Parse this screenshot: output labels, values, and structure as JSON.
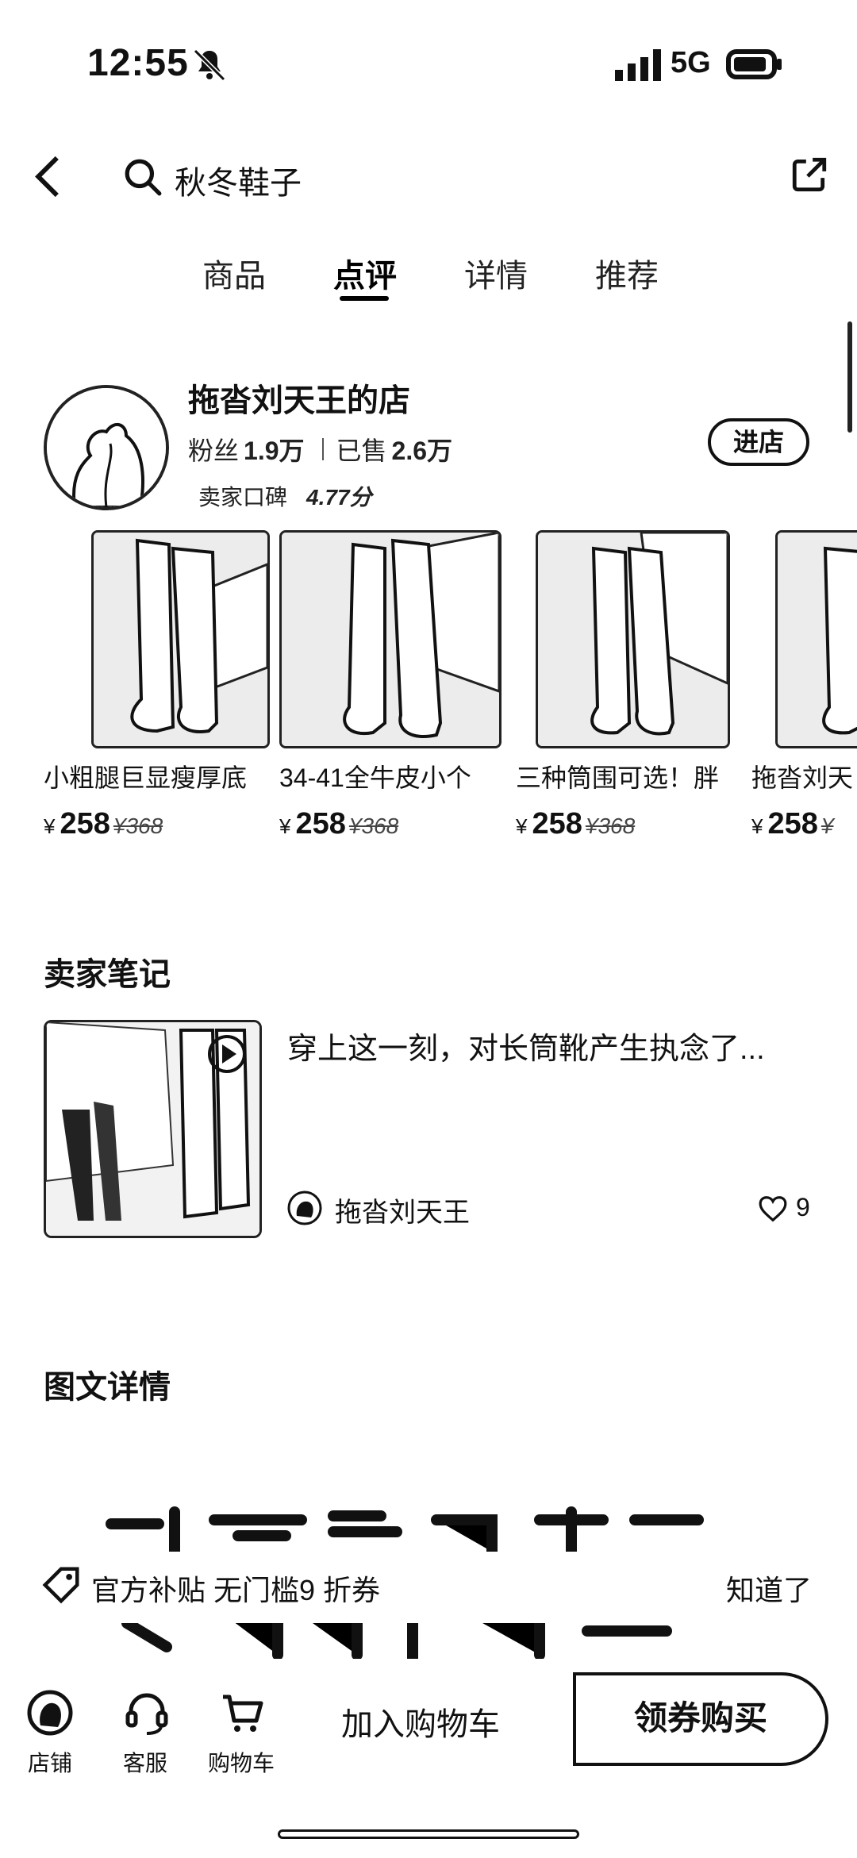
{
  "status_bar": {
    "time": "12:55",
    "network": "5G"
  },
  "header": {
    "search_query": "秋冬鞋子"
  },
  "tabs": [
    {
      "label": "商品"
    },
    {
      "label": "点评"
    },
    {
      "label": "详情"
    },
    {
      "label": "推荐"
    }
  ],
  "active_tab": "点评",
  "shop": {
    "name": "拖沓刘天王的店",
    "fans_label": "粉丝",
    "fans_count": "1.9万",
    "sold_label": "已售",
    "sold_count": "2.6万",
    "rating_label": "卖家口碑",
    "rating_value": "4.77分",
    "enter_label": "进店"
  },
  "products": [
    {
      "name": "小粗腿巨显瘦厚底",
      "currency": "¥",
      "price": "258",
      "original_price": "¥368"
    },
    {
      "name": "34-41全牛皮小个",
      "currency": "¥",
      "price": "258",
      "original_price": "¥368"
    },
    {
      "name": "三种筒围可选！胖",
      "currency": "¥",
      "price": "258",
      "original_price": "¥368"
    },
    {
      "name": "拖沓刘天",
      "currency": "¥",
      "price": "258",
      "original_price": "¥"
    }
  ],
  "seller_notes": {
    "title": "卖家笔记",
    "note_text": "穿上这一刻，对长筒靴产生执念了...",
    "author": "拖沓刘天王",
    "likes": "9"
  },
  "details": {
    "title": "图文详情"
  },
  "promo": {
    "text": "官方补贴  无门槛9 折券",
    "dismiss": "知道了"
  },
  "bottom_bar": {
    "shop_label": "店铺",
    "service_label": "客服",
    "cart_label": "购物车",
    "add_to_cart": "加入购物车",
    "buy": "领券购买"
  }
}
